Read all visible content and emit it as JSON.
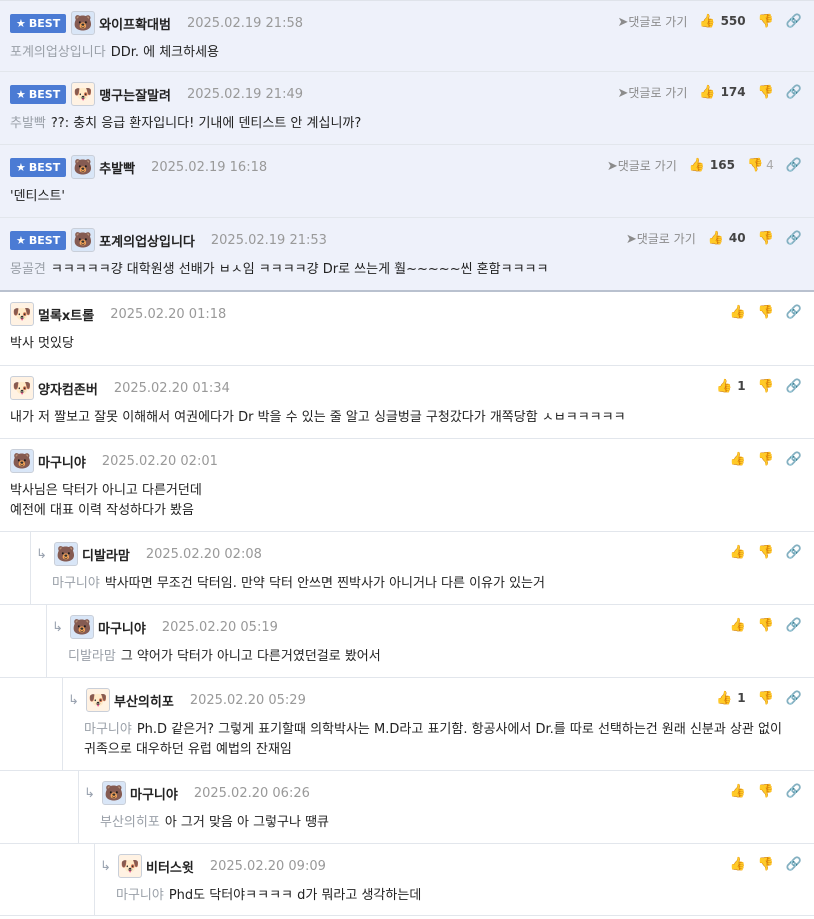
{
  "ui": {
    "reply_link": "댓글로 가기",
    "best_label": "BEST"
  },
  "comments": [
    {
      "best": true,
      "depth": 0,
      "avatar": "blue",
      "nick": "와이프확대범",
      "date": "2025.02.19 21:58",
      "likes": "550",
      "dislikes": "",
      "mention": "포계의업상입니다",
      "lines": [
        "DDr. 에 체크하세용"
      ]
    },
    {
      "best": true,
      "depth": 0,
      "avatar": "dog",
      "nick": "맹구는잘말려",
      "date": "2025.02.19 21:49",
      "likes": "174",
      "dislikes": "",
      "mention": "추발빡",
      "lines": [
        "??: 충치 응급 환자입니다! 기내에 덴티스트 안 계십니까?"
      ]
    },
    {
      "best": true,
      "depth": 0,
      "avatar": "blue",
      "nick": "추발빡",
      "date": "2025.02.19 16:18",
      "likes": "165",
      "dislikes": "4",
      "mention": "",
      "lines": [
        "'덴티스트'"
      ]
    },
    {
      "best": true,
      "depth": 0,
      "avatar": "blue",
      "nick": "포계의업상입니다",
      "date": "2025.02.19 21:53",
      "likes": "40",
      "dislikes": "",
      "mention": "몽골견",
      "lines": [
        "ㅋㅋㅋㅋㅋ걍 대학원생 선배가 ㅂㅅ임 ㅋㅋㅋㅋ걍 Dr로 쓰는게 훨~~~~~씬 혼함ㅋㅋㅋㅋ"
      ]
    },
    {
      "best": false,
      "depth": 0,
      "avatar": "dog",
      "nick": "멀록x트롤",
      "date": "2025.02.20 01:18",
      "likes": "",
      "dislikes": "",
      "mention": "",
      "lines": [
        "박사 멋있당"
      ]
    },
    {
      "best": false,
      "depth": 0,
      "avatar": "dog",
      "nick": "양자컴존버",
      "date": "2025.02.20 01:34",
      "likes": "1",
      "dislikes": "",
      "mention": "",
      "lines": [
        "내가 저 짤보고 잘못 이해해서 여권에다가 Dr 박을 수 있는 줄 알고 싱글벙글 구청갔다가 개쪽당함 ㅅㅂㅋㅋㅋㅋㅋ"
      ]
    },
    {
      "best": false,
      "depth": 0,
      "avatar": "blue",
      "nick": "마구니야",
      "date": "2025.02.20 02:01",
      "likes": "",
      "dislikes": "",
      "mention": "",
      "lines": [
        "박사님은 닥터가 아니고 다른거던데",
        "예전에 대표 이력 작성하다가 봤음"
      ]
    },
    {
      "best": false,
      "depth": 1,
      "avatar": "blue",
      "nick": "디발라맘",
      "date": "2025.02.20 02:08",
      "likes": "",
      "dislikes": "",
      "mention": "마구니야",
      "lines": [
        "박사따면 무조건 닥터임. 만약 닥터 안쓰면 찐박사가 아니거나 다른 이유가 있는거"
      ]
    },
    {
      "best": false,
      "depth": 2,
      "avatar": "blue",
      "nick": "마구니야",
      "date": "2025.02.20 05:19",
      "likes": "",
      "dislikes": "",
      "mention": "디발라맘",
      "lines": [
        "그 약어가 닥터가 아니고 다른거였던걸로 봤어서"
      ]
    },
    {
      "best": false,
      "depth": 3,
      "avatar": "dog",
      "nick": "부산의히포",
      "date": "2025.02.20 05:29",
      "likes": "1",
      "dislikes": "",
      "mention": "마구니야",
      "lines": [
        "Ph.D 같은거? 그렇게 표기할때 의학박사는 M.D라고 표기함. 항공사에서 Dr.를 따로 선택하는건 원래 신분과 상관 없이",
        "귀족으로 대우하던 유럽 예법의 잔재임"
      ]
    },
    {
      "best": false,
      "depth": 4,
      "avatar": "blue",
      "nick": "마구니야",
      "date": "2025.02.20 06:26",
      "likes": "",
      "dislikes": "",
      "mention": "부산의히포",
      "lines": [
        "아 그거 맞음 아 그렇구나 땡큐"
      ]
    },
    {
      "best": false,
      "depth": 5,
      "avatar": "dog",
      "nick": "비터스윗",
      "date": "2025.02.20 09:09",
      "likes": "",
      "dislikes": "",
      "mention": "마구니야",
      "lines": [
        "Phd도 닥터야ㅋㅋㅋㅋ d가 뭐라고 생각하는데"
      ]
    }
  ]
}
